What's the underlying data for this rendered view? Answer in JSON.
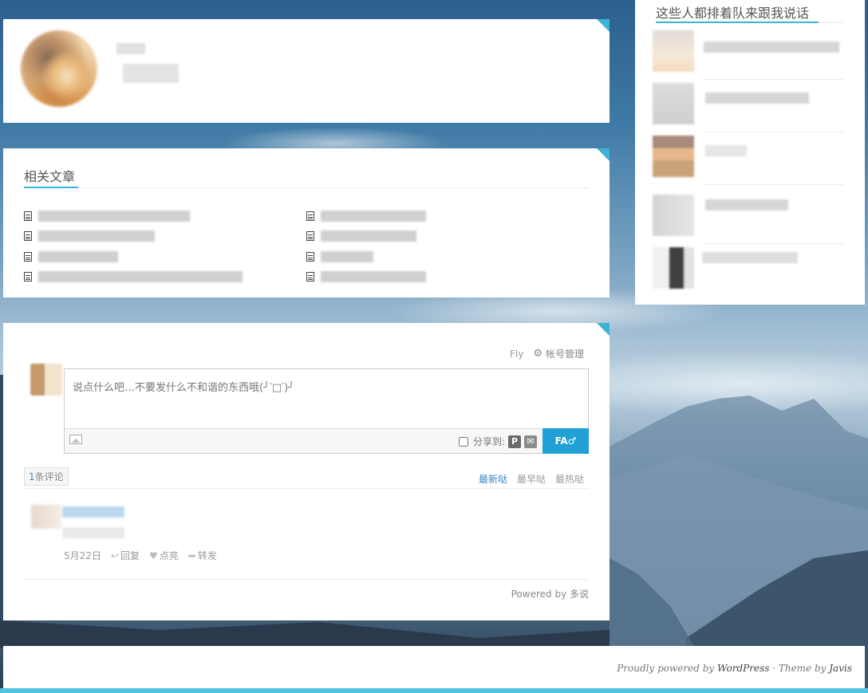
{
  "related": {
    "title": "相关文章"
  },
  "comments": {
    "username": "Fly",
    "account_manage": "帐号管理",
    "placeholder": "说点什么吧…不要发什么不和谐的东西哦(╯‵□′)╯",
    "share_label": "分享到:",
    "post_button": "FA♂",
    "count_num": "1",
    "count_label": "条评论",
    "sort": [
      "最新哒",
      "最早哒",
      "最热哒"
    ],
    "actions": {
      "date": "5月22日",
      "reply": "回复",
      "like": "点亮",
      "repost": "转发"
    },
    "powered_by": "Powered by 多说"
  },
  "sidebar": {
    "title": "这些人都排着队来跟我说话"
  },
  "footer": {
    "proudly": "Proudly powered by ",
    "wordpress": "WordPress",
    "theme_sep": " · Theme by ",
    "javis": "Javis"
  },
  "colors": {
    "accent": "#3bb3d6",
    "button": "#21a0d6",
    "link": "#3a85c6"
  },
  "icons": {
    "gear": "gear-icon",
    "doc": "document-icon",
    "image": "image-icon",
    "reply": "reply-icon",
    "heart": "heart-icon",
    "repost": "repost-icon"
  }
}
